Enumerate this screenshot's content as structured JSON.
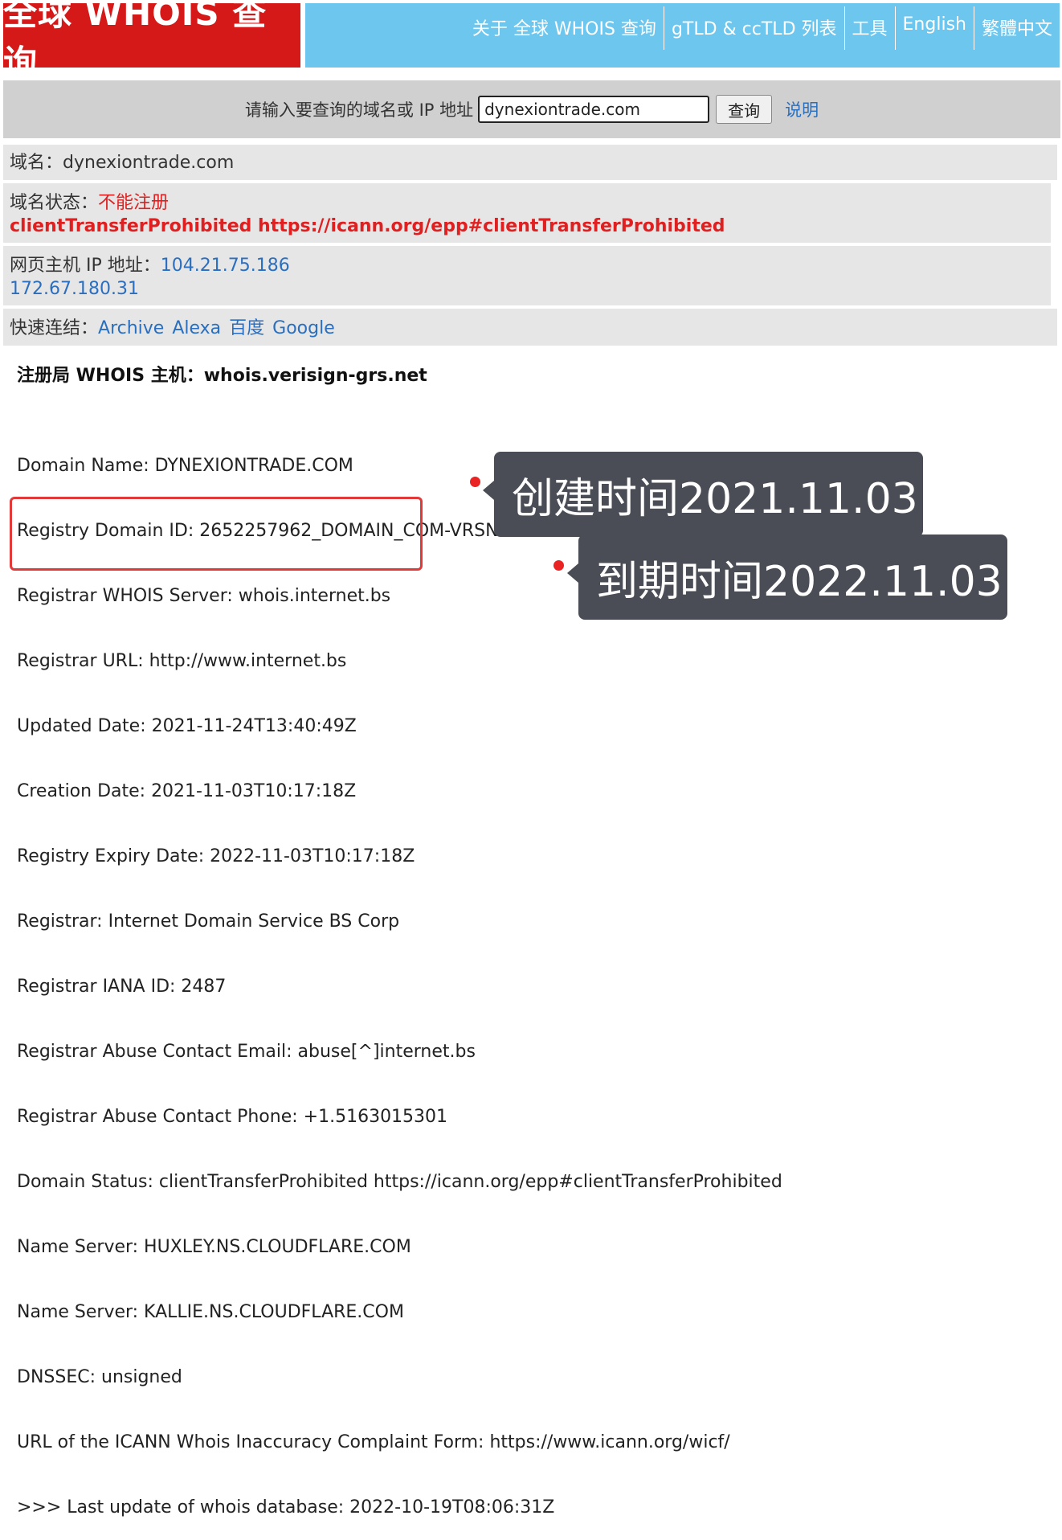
{
  "logo": {
    "text": "全球 WHOIS 查询"
  },
  "nav": {
    "items": [
      "关于 全球 WHOIS 查询",
      "gTLD & ccTLD 列表",
      "工具",
      "English",
      "繁體中文"
    ]
  },
  "search": {
    "prompt": "请输入要查询的域名或 IP 地址",
    "value": "dynexiontrade.com",
    "button": "查询",
    "help": "说明"
  },
  "domain": {
    "label": "域名：",
    "value": "dynexiontrade.com"
  },
  "status": {
    "label": "域名状态：",
    "value": "不能注册",
    "detail": "clientTransferProhibited https://icann.org/epp#clientTransferProhibited"
  },
  "host_ip": {
    "label": "网页主机 IP 地址：",
    "ip1": "104.21.75.186",
    "ip2": "172.67.180.31"
  },
  "quick_links": {
    "label": "快速连结：",
    "items": [
      "Archive",
      "Alexa",
      "百度",
      "Google"
    ]
  },
  "whois": {
    "heading": "注册局 WHOIS 主机：whois.verisign-grs.net",
    "lines": [
      "Domain Name: DYNEXIONTRADE.COM",
      "Registry Domain ID: 2652257962_DOMAIN_COM-VRSN",
      "Registrar WHOIS Server: whois.internet.bs",
      "Registrar URL: http://www.internet.bs",
      "Updated Date: 2021-11-24T13:40:49Z",
      "Creation Date: 2021-11-03T10:17:18Z",
      "Registry Expiry Date: 2022-11-03T10:17:18Z",
      "Registrar: Internet Domain Service BS Corp",
      "Registrar IANA ID: 2487",
      "Registrar Abuse Contact Email: abuse[^]internet.bs",
      "Registrar Abuse Contact Phone: +1.5163015301",
      "Domain Status: clientTransferProhibited https://icann.org/epp#clientTransferProhibited",
      "Name Server: HUXLEY.NS.CLOUDFLARE.COM",
      "Name Server: KALLIE.NS.CLOUDFLARE.COM",
      "DNSSEC: unsigned",
      "URL of the ICANN Whois Inaccuracy Complaint Form: https://www.icann.org/wicf/",
      ">>> Last update of whois database: 2022-10-19T08:06:31Z"
    ]
  },
  "annotations": {
    "created": "创建时间2021.11.03",
    "expires": "到期时间2022.11.03"
  }
}
